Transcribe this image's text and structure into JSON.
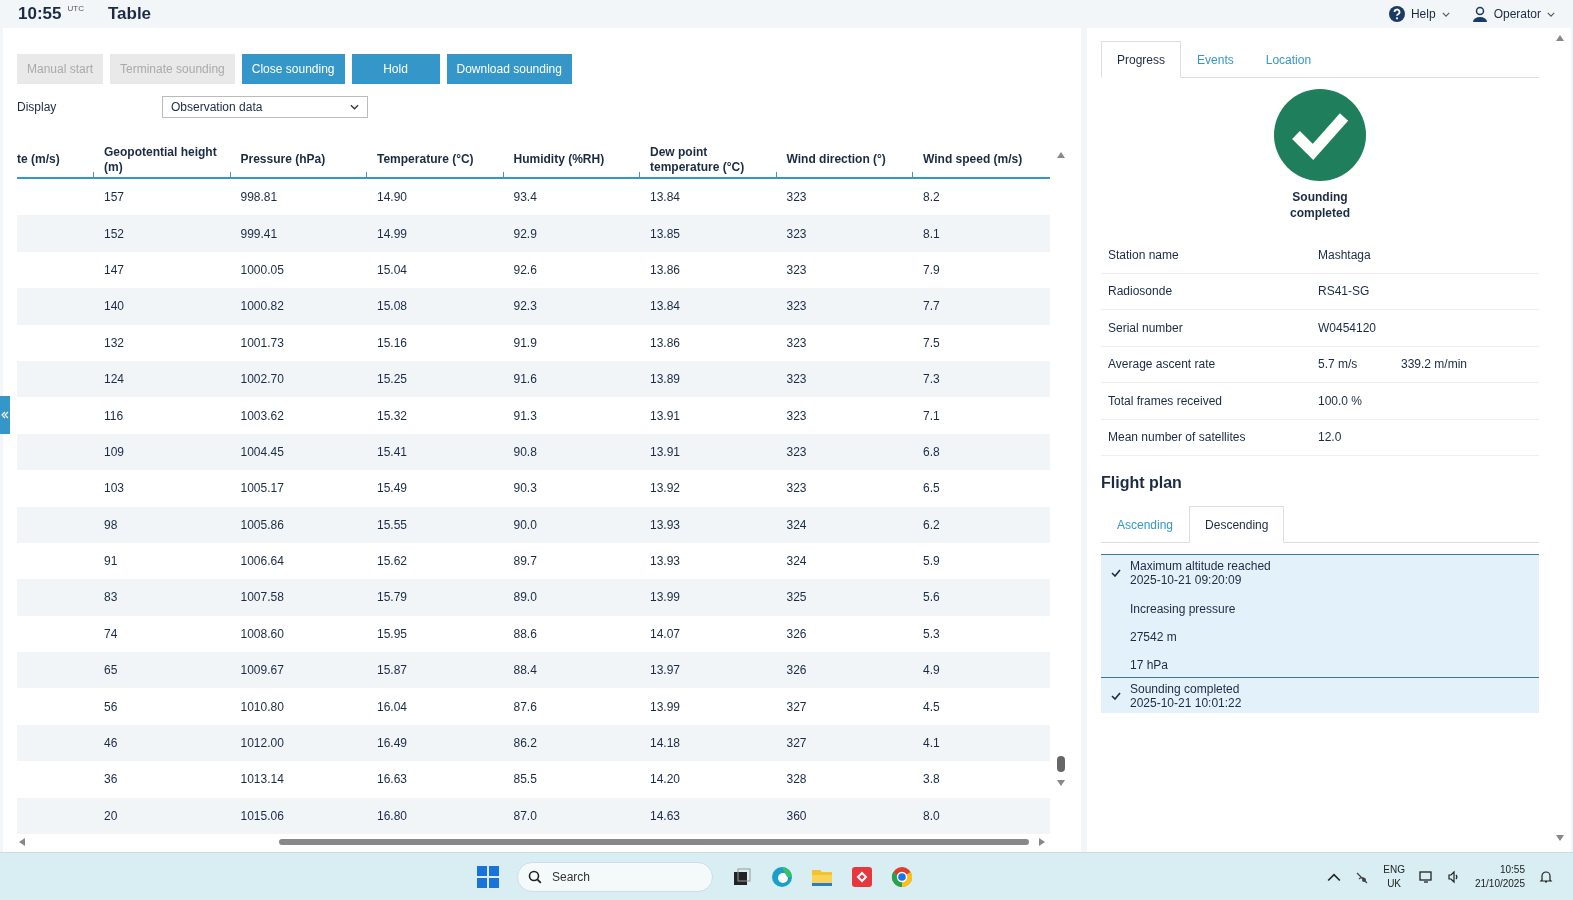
{
  "header": {
    "time": "10:55",
    "timezone": "UTC",
    "title": "Table",
    "help": "Help",
    "user": "Operator"
  },
  "toolbar": {
    "buttons": [
      {
        "label": "Manual start",
        "disabled": true
      },
      {
        "label": "Terminate sounding",
        "disabled": true
      },
      {
        "label": "Close sounding",
        "disabled": false
      },
      {
        "label": "Hold",
        "disabled": false
      },
      {
        "label": "Download sounding",
        "disabled": false
      }
    ],
    "display_label": "Display",
    "display_value": "Observation data"
  },
  "table": {
    "columns": [
      "te (m/s)",
      "Geopotential height (m)",
      "Pressure (hPa)",
      "Temperature (°C)",
      "Humidity (%RH)",
      "Dew point temperature (°C)",
      "Wind direction (°)",
      "Wind speed (m/s)"
    ],
    "rows": [
      [
        "",
        "157",
        "998.81",
        "14.90",
        "93.4",
        "13.84",
        "323",
        "8.2"
      ],
      [
        "",
        "152",
        "999.41",
        "14.99",
        "92.9",
        "13.85",
        "323",
        "8.1"
      ],
      [
        "",
        "147",
        "1000.05",
        "15.04",
        "92.6",
        "13.86",
        "323",
        "7.9"
      ],
      [
        "",
        "140",
        "1000.82",
        "15.08",
        "92.3",
        "13.84",
        "323",
        "7.7"
      ],
      [
        "",
        "132",
        "1001.73",
        "15.16",
        "91.9",
        "13.86",
        "323",
        "7.5"
      ],
      [
        "",
        "124",
        "1002.70",
        "15.25",
        "91.6",
        "13.89",
        "323",
        "7.3"
      ],
      [
        "",
        "116",
        "1003.62",
        "15.32",
        "91.3",
        "13.91",
        "323",
        "7.1"
      ],
      [
        "",
        "109",
        "1004.45",
        "15.41",
        "90.8",
        "13.91",
        "323",
        "6.8"
      ],
      [
        "",
        "103",
        "1005.17",
        "15.49",
        "90.3",
        "13.92",
        "323",
        "6.5"
      ],
      [
        "",
        "98",
        "1005.86",
        "15.55",
        "90.0",
        "13.93",
        "324",
        "6.2"
      ],
      [
        "",
        "91",
        "1006.64",
        "15.62",
        "89.7",
        "13.93",
        "324",
        "5.9"
      ],
      [
        "",
        "83",
        "1007.58",
        "15.79",
        "89.0",
        "13.99",
        "325",
        "5.6"
      ],
      [
        "",
        "74",
        "1008.60",
        "15.95",
        "88.6",
        "14.07",
        "326",
        "5.3"
      ],
      [
        "",
        "65",
        "1009.67",
        "15.87",
        "88.4",
        "13.97",
        "326",
        "4.9"
      ],
      [
        "",
        "56",
        "1010.80",
        "16.04",
        "87.6",
        "13.99",
        "327",
        "4.5"
      ],
      [
        "",
        "46",
        "1012.00",
        "16.49",
        "86.2",
        "14.18",
        "327",
        "4.1"
      ],
      [
        "",
        "36",
        "1013.14",
        "16.63",
        "85.5",
        "14.20",
        "328",
        "3.8"
      ],
      [
        "",
        "20",
        "1015.06",
        "16.80",
        "87.0",
        "14.63",
        "360",
        "8.0"
      ]
    ]
  },
  "side_panel": {
    "tabs": [
      {
        "label": "Progress",
        "selected": true
      },
      {
        "label": "Events",
        "selected": false
      },
      {
        "label": "Location",
        "selected": false
      }
    ],
    "status": "Sounding completed",
    "details": [
      {
        "label": "Station name",
        "values": [
          "Mashtaga"
        ]
      },
      {
        "label": "Radiosonde",
        "values": [
          "RS41-SG"
        ]
      },
      {
        "label": "Serial number",
        "values": [
          "W0454120"
        ]
      },
      {
        "label": "Average ascent rate",
        "values": [
          "5.7 m/s",
          "339.2 m/min"
        ]
      },
      {
        "label": "Total frames received",
        "values": [
          "100.0 %"
        ]
      },
      {
        "label": "Mean number of satellites",
        "values": [
          "12.0"
        ]
      }
    ],
    "flight_plan": {
      "title": "Flight plan",
      "tabs": [
        {
          "label": "Ascending",
          "selected": false
        },
        {
          "label": "Descending",
          "selected": true
        }
      ],
      "steps": [
        {
          "checked": true,
          "title": "Maximum altitude reached",
          "time": "2025-10-21 09:20:09",
          "details": [
            "Increasing pressure",
            "27542 m",
            "17 hPa"
          ]
        },
        {
          "checked": true,
          "title": "Sounding completed",
          "time": "2025-10-21 10:01:22"
        }
      ]
    }
  },
  "taskbar": {
    "search_placeholder": "Search",
    "language": "ENG",
    "region": "UK",
    "time": "10:55",
    "date": "21/10/2025"
  }
}
